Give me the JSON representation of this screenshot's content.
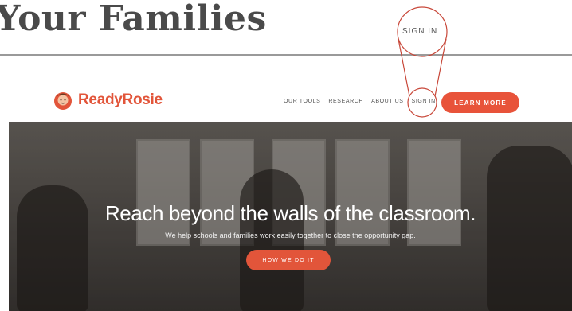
{
  "header": {
    "title": "Your Families",
    "zoom_signin": "SIGN IN"
  },
  "site": {
    "logo_text": "ReadyRosie",
    "nav": [
      "OUR TOOLS",
      "RESEARCH",
      "ABOUT US",
      "SIGN IN"
    ],
    "cta": "LEARN MORE"
  },
  "hero": {
    "title": "Reach beyond the walls of the classroom.",
    "subtitle": "We help schools and families work easily together to close the opportunity gap.",
    "button": "HOW WE DO IT"
  },
  "colors": {
    "accent": "#e8533a",
    "logo": "#e2553a",
    "title": "#4a4a4a"
  },
  "icons": {
    "logo_mark": "readyrosie-logo-icon"
  }
}
